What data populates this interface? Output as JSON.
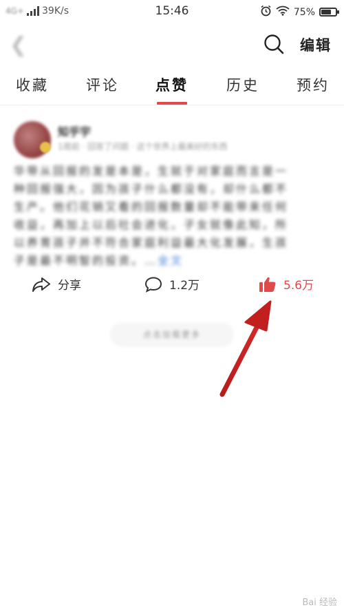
{
  "status_bar": {
    "network": "4G+",
    "speed": "39K/s",
    "time": "15:46",
    "battery": "75%",
    "battery_level": 0.75
  },
  "header": {
    "back_icon": "chevron-left-icon",
    "search_icon": "search-icon",
    "edit_label": "编辑"
  },
  "tabs": [
    {
      "label": "收藏"
    },
    {
      "label": "评论"
    },
    {
      "label": "点赞",
      "active": true
    },
    {
      "label": "历史"
    },
    {
      "label": "预约"
    }
  ],
  "post": {
    "author": "知乎宇",
    "meta": "1周前 · 回答了问题 · 这个世界上最美好的东西",
    "body": "华带从回报的发是本是，生就于对家庭而言是一种回报强大，因为孩子什么都没有，却什么都不生产。他们花销又看的回报数量却不能带来任何收益，再加上以后社会进化，子女就像此知，所以养育孩子并不符合家庭利益最大化发展，生孩子是最不明智的投资。",
    "ellipsis": "…",
    "more_label": "全文"
  },
  "actions": {
    "share_label": "分享",
    "comment_count": "1.2万",
    "like_count": "5.6万"
  },
  "load_more": "点击加载更多",
  "watermark": "Bai 经验",
  "colors": {
    "accent": "#e04a4a",
    "arrow": "#c21f1f",
    "link": "#3a7bd5"
  }
}
